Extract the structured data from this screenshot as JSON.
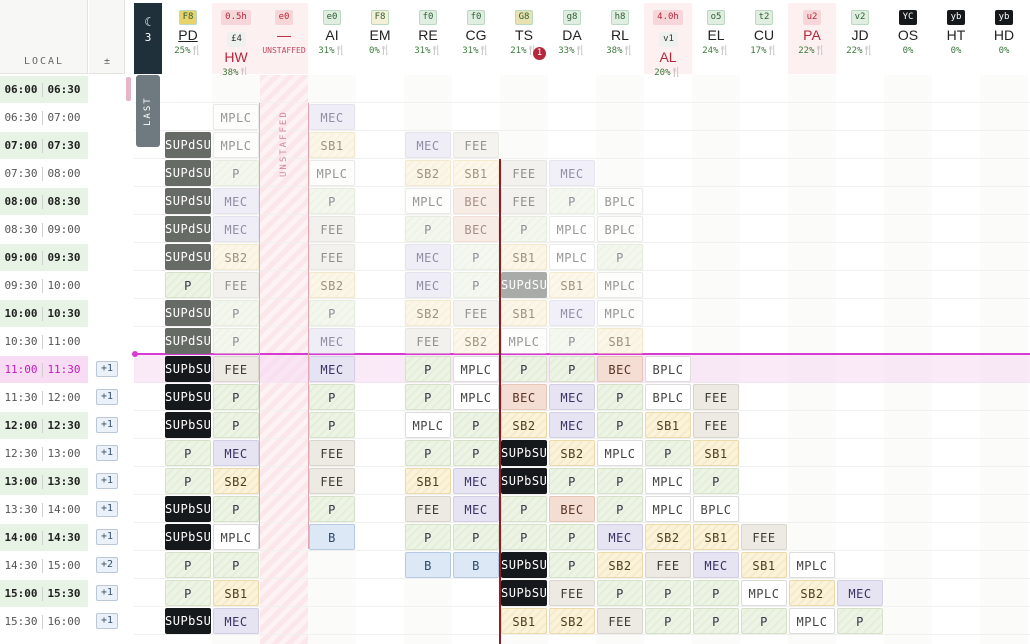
{
  "header": {
    "local_label": "LOCAL",
    "pm_label": "±",
    "night_count": "3",
    "night_label": "LAST NIGHT",
    "unstaffed_col_label": "UNSTAFFED"
  },
  "columns": [
    {
      "code": "PD",
      "badge": "F8",
      "pct": "25%🍴",
      "badge_color": "#e8d26a",
      "code_color": "#222"
    },
    {
      "code": "HW",
      "badge": "0.5h",
      "badge2": "£4",
      "pct": "38%🍴",
      "badge_color": "#f7d6d9",
      "code_color": "#b3283a"
    },
    {
      "code": "—",
      "badge": "e0",
      "pct": "UNSTAFFED",
      "badge_color": "#f7d6d9",
      "code_color": "#b3283a"
    },
    {
      "code": "AI",
      "badge": "e0",
      "pct": "31%🍴",
      "badge_color": "#dfeee0",
      "code_color": "#222"
    },
    {
      "code": "EM",
      "badge": "F8",
      "pct": "0%🍴",
      "badge_color": "#f4f0d8",
      "code_color": "#222"
    },
    {
      "code": "RE",
      "badge": "f0",
      "pct": "31%🍴",
      "badge_color": "#dfeee0",
      "code_color": "#222"
    },
    {
      "code": "CG",
      "badge": "f0",
      "pct": "31%🍴",
      "badge_color": "#dfeee0",
      "code_color": "#222"
    },
    {
      "code": "TS",
      "badge": "G8",
      "pct": "21%🍴",
      "badge_color": "#e8e2b0",
      "code_color": "#222",
      "alert": "1"
    },
    {
      "code": "DA",
      "badge": "g8",
      "pct": "33%🍴",
      "badge_color": "#dfeee0",
      "code_color": "#222"
    },
    {
      "code": "RL",
      "badge": "h8",
      "pct": "38%🍴",
      "badge_color": "#dfeee0",
      "code_color": "#222"
    },
    {
      "code": "AL",
      "badge": "4.0h",
      "badge2": "v1",
      "pct": "20%🍴",
      "badge_color": "#f7d6d9",
      "code_color": "#b3283a"
    },
    {
      "code": "EL",
      "badge": "o5",
      "pct": "24%🍴",
      "badge_color": "#dfeee0",
      "code_color": "#222"
    },
    {
      "code": "CU",
      "badge": "t2",
      "pct": "17%🍴",
      "badge_color": "#dfeee0",
      "code_color": "#222"
    },
    {
      "code": "PA",
      "badge": "u2",
      "pct": "22%🍴",
      "badge_color": "#f7d6d9",
      "code_color": "#b3283a"
    },
    {
      "code": "JD",
      "badge": "v2",
      "pct": "22%🍴",
      "badge_color": "#dfeee0",
      "code_color": "#222"
    },
    {
      "code": "OS",
      "badge": "YC",
      "pct": "0%",
      "badge_color": "#16191b",
      "code_color": "#222"
    },
    {
      "code": "HT",
      "badge": "yb",
      "pct": "0%",
      "badge_color": "#16191b",
      "code_color": "#222"
    },
    {
      "code": "HD",
      "badge": "yb",
      "pct": "0%",
      "badge_color": "#16191b",
      "code_color": "#222"
    }
  ],
  "rows": [
    {
      "start": "06:00",
      "end": "06:30",
      "bold": true,
      "plus": ""
    },
    {
      "start": "06:30",
      "end": "07:00",
      "bold": false,
      "plus": ""
    },
    {
      "start": "07:00",
      "end": "07:30",
      "bold": true,
      "plus": ""
    },
    {
      "start": "07:30",
      "end": "08:00",
      "bold": false,
      "plus": ""
    },
    {
      "start": "08:00",
      "end": "08:30",
      "bold": true,
      "plus": ""
    },
    {
      "start": "08:30",
      "end": "09:00",
      "bold": false,
      "plus": ""
    },
    {
      "start": "09:00",
      "end": "09:30",
      "bold": true,
      "plus": ""
    },
    {
      "start": "09:30",
      "end": "10:00",
      "bold": false,
      "plus": ""
    },
    {
      "start": "10:00",
      "end": "10:30",
      "bold": true,
      "plus": ""
    },
    {
      "start": "10:30",
      "end": "11:00",
      "bold": false,
      "plus": ""
    },
    {
      "start": "11:00",
      "end": "11:30",
      "bold": true,
      "plus": "+1",
      "current": true
    },
    {
      "start": "11:30",
      "end": "12:00",
      "bold": false,
      "plus": "+1"
    },
    {
      "start": "12:00",
      "end": "12:30",
      "bold": true,
      "plus": "+1"
    },
    {
      "start": "12:30",
      "end": "13:00",
      "bold": false,
      "plus": "+1"
    },
    {
      "start": "13:00",
      "end": "13:30",
      "bold": true,
      "plus": "+1"
    },
    {
      "start": "13:30",
      "end": "14:00",
      "bold": false,
      "plus": "+1"
    },
    {
      "start": "14:00",
      "end": "14:30",
      "bold": true,
      "plus": "+1"
    },
    {
      "start": "14:30",
      "end": "15:00",
      "bold": false,
      "plus": "+2"
    },
    {
      "start": "15:00",
      "end": "15:30",
      "bold": true,
      "plus": "+1"
    },
    {
      "start": "15:30",
      "end": "16:00",
      "bold": false,
      "plus": "+1"
    }
  ],
  "grid": [
    [
      "",
      "",
      "",
      "",
      "",
      "",
      "",
      "",
      "",
      "",
      "",
      "",
      "",
      "",
      "",
      "",
      "",
      ""
    ],
    [
      "",
      "MPLC",
      "",
      "MEC",
      "",
      "",
      "",
      "",
      "",
      "",
      "",
      "",
      "",
      "",
      "",
      "",
      "",
      ""
    ],
    [
      "SUPd",
      "MPLC",
      "",
      "SB1",
      "",
      "MEC",
      "FEE",
      "",
      "",
      "",
      "",
      "",
      "",
      "",
      "",
      "",
      "",
      ""
    ],
    [
      "SUPd",
      "P",
      "",
      "MPLC",
      "",
      "SB2",
      "SB1",
      "FEE",
      "MEC",
      "",
      "",
      "",
      "",
      "",
      "",
      "",
      "",
      ""
    ],
    [
      "SUPd",
      "MEC",
      "",
      "P",
      "",
      "MPLC",
      "BEC",
      "FEE",
      "P",
      "BPLC",
      "",
      "",
      "",
      "",
      "",
      "",
      "",
      ""
    ],
    [
      "SUPd",
      "MEC",
      "",
      "FEE",
      "",
      "P",
      "BEC",
      "P",
      "MPLC",
      "BPLC",
      "",
      "",
      "",
      "",
      "",
      "",
      "",
      ""
    ],
    [
      "SUPd",
      "SB2",
      "",
      "FEE",
      "",
      "MEC",
      "P",
      "SB1",
      "MPLC",
      "P",
      "",
      "",
      "",
      "",
      "",
      "",
      "",
      ""
    ],
    [
      "P",
      "FEE",
      "",
      "SB2",
      "",
      "MEC",
      "P",
      "SUPd",
      "SB1",
      "MPLC",
      "",
      "",
      "",
      "",
      "",
      "",
      "",
      ""
    ],
    [
      "SUPd",
      "P",
      "",
      "P",
      "",
      "SB2",
      "FEE",
      "SB1",
      "MEC",
      "MPLC",
      "",
      "",
      "",
      "",
      "",
      "",
      "",
      ""
    ],
    [
      "SUPd",
      "P",
      "",
      "MEC",
      "",
      "FEE",
      "SB2",
      "MPLC",
      "P",
      "SB1",
      "",
      "",
      "",
      "",
      "",
      "",
      "",
      ""
    ],
    [
      "SUPb",
      "FEE",
      "",
      "MEC",
      "",
      "P",
      "MPLC",
      "P",
      "P",
      "BEC",
      "BPLC",
      "",
      "",
      "",
      "",
      "",
      "",
      ""
    ],
    [
      "SUPb",
      "P",
      "",
      "P",
      "",
      "P",
      "MPLC",
      "BEC",
      "MEC",
      "P",
      "BPLC",
      "FEE",
      "",
      "",
      "",
      "",
      "",
      ""
    ],
    [
      "SUPb",
      "P",
      "",
      "P",
      "",
      "MPLC",
      "P",
      "SB2",
      "MEC",
      "P",
      "SB1",
      "FEE",
      "",
      "",
      "",
      "",
      "",
      ""
    ],
    [
      "P",
      "MEC",
      "",
      "FEE",
      "",
      "P",
      "P",
      "SUPb",
      "SB2",
      "MPLC",
      "P",
      "SB1",
      "",
      "",
      "",
      "",
      "",
      ""
    ],
    [
      "P",
      "SB2",
      "",
      "FEE",
      "",
      "SB1",
      "MEC",
      "SUPb",
      "P",
      "P",
      "MPLC",
      "P",
      "",
      "",
      "",
      "",
      "",
      ""
    ],
    [
      "SUPb",
      "P",
      "",
      "P",
      "",
      "FEE",
      "MEC",
      "P",
      "BEC",
      "P",
      "MPLC",
      "BPLC",
      "",
      "",
      "",
      "",
      "",
      ""
    ],
    [
      "SUPb",
      "MPLC",
      "",
      "B",
      "",
      "P",
      "P",
      "P",
      "P",
      "MEC",
      "SB2",
      "SB1",
      "FEE",
      "",
      "",
      "",
      "",
      ""
    ],
    [
      "P",
      "P",
      "",
      "",
      "",
      "B",
      "B",
      "SUPb",
      "P",
      "SB2",
      "FEE",
      "MEC",
      "SB1",
      "MPLC",
      "",
      "",
      "",
      ""
    ],
    [
      "P",
      "SB1",
      "",
      "",
      "",
      "",
      "",
      "SUPb",
      "FEE",
      "P",
      "P",
      "P",
      "MPLC",
      "SB2",
      "MEC",
      "",
      "",
      ""
    ],
    [
      "SUPb",
      "MEC",
      "",
      "",
      "",
      "",
      "",
      "SB1",
      "SB2",
      "FEE",
      "P",
      "P",
      "P",
      "MPLC",
      "P",
      "",
      "",
      ""
    ]
  ]
}
